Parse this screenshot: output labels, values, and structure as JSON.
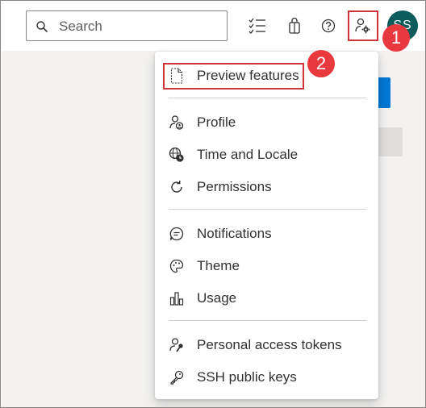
{
  "search": {
    "placeholder": "Search"
  },
  "toolbar": {
    "work_items_icon": "checklist-icon",
    "marketplace_icon": "shopping-bag-icon",
    "help_icon": "help-icon",
    "user_settings_icon": "user-settings-icon",
    "avatar_initials": "SS",
    "avatar_color": "#0b5c5a"
  },
  "annotations": {
    "step1": "1",
    "step2": "2",
    "highlight_color": "#d13438",
    "badge_color": "#e8393f"
  },
  "menu": {
    "sections": [
      {
        "items": [
          {
            "label": "Preview features",
            "icon": "document-icon"
          }
        ]
      },
      {
        "items": [
          {
            "label": "Profile",
            "icon": "profile-icon"
          },
          {
            "label": "Time and Locale",
            "icon": "globe-clock-icon"
          },
          {
            "label": "Permissions",
            "icon": "refresh-icon"
          }
        ]
      },
      {
        "items": [
          {
            "label": "Notifications",
            "icon": "chat-bubble-icon"
          },
          {
            "label": "Theme",
            "icon": "palette-icon"
          },
          {
            "label": "Usage",
            "icon": "bar-chart-icon"
          }
        ]
      },
      {
        "items": [
          {
            "label": "Personal access tokens",
            "icon": "person-key-icon"
          },
          {
            "label": "SSH public keys",
            "icon": "key-icon"
          }
        ]
      }
    ]
  }
}
